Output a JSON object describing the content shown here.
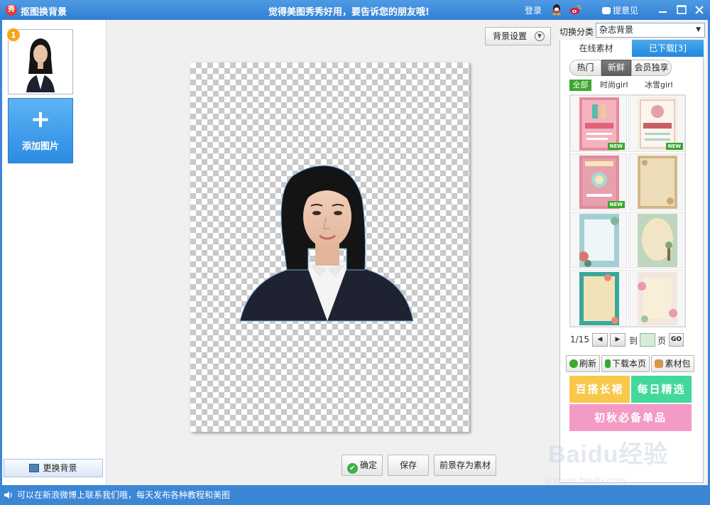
{
  "titlebar": {
    "app_title": "抠图换背景",
    "app_icon_glyph": "秀",
    "slogan": "觉得美图秀秀好用，要告诉您的朋友哦!",
    "login": "登录",
    "feedback": "提意见",
    "icons": [
      "qq-icon",
      "weibo-icon",
      "feedback-icon",
      "minimize-icon",
      "maximize-icon",
      "close-icon"
    ]
  },
  "left_panel": {
    "thumb_badge": "1",
    "add_plus": "+",
    "add_label": "添加图片",
    "change_bg_label": "更换背景"
  },
  "canvas": {
    "bg_settings_label": "背景设置",
    "confirm_label": "确定",
    "save_label": "保存",
    "save_fg_label": "前景存为素材"
  },
  "right_panel": {
    "category_label": "切换分类",
    "category_value": "杂志背景",
    "tabs": {
      "online": "在线素材",
      "downloaded": "已下载[3]"
    },
    "segments": {
      "hot": "热门",
      "new": "新鲜",
      "vip": "会员独享"
    },
    "filters": {
      "all": "全部",
      "fashion": "时尚girl",
      "ice": "冰雪girl"
    },
    "new_tag": "NEW",
    "pager": {
      "page": "1/15",
      "to": "到",
      "page_unit": "页",
      "go": "GO"
    },
    "tools": {
      "refresh": "刷新",
      "download_page": "下载本页",
      "pack": "素材包"
    },
    "promos": {
      "p1": "百搭长裙",
      "p2": "每日精选",
      "p3": "初秋必备单品"
    }
  },
  "status": {
    "text": "可以在新浪微博上联系我们哦，每天发布各种教程和美图"
  },
  "watermark": {
    "main": "Baidu经验",
    "sub": "jingyan.baidu.com"
  },
  "colors": {
    "titlebar": "#2f7fd2",
    "accent_green": "#3aa72f",
    "promo_yellow": "#f8c84a",
    "promo_green": "#43d99b",
    "promo_pink": "#f49ac6"
  }
}
